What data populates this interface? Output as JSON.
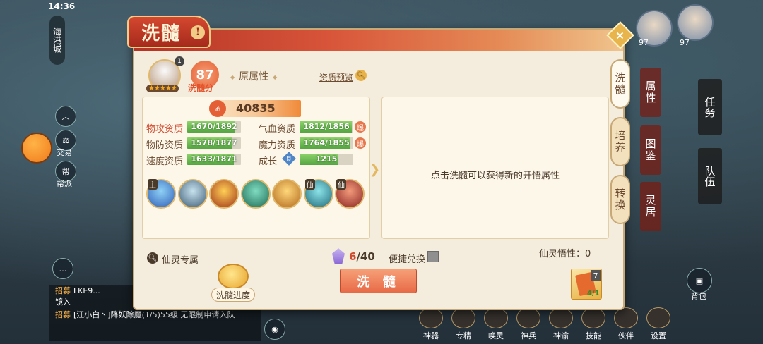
{
  "status": {
    "time": "14:36"
  },
  "background_ui": {
    "location_tab": "海港城",
    "side_buttons": [
      "交易",
      "帮派"
    ],
    "chat": [
      {
        "tag": "招募",
        "text": "LKE9..."
      },
      {
        "tag": "",
        "text": "镜入"
      },
      {
        "tag": "招募",
        "text": "[江小白丶]降妖除魔(1/5)55级 无限制申请入队"
      }
    ],
    "bottom_menu": [
      "神器",
      "专精",
      "唤灵",
      "神兵",
      "神谕",
      "技能",
      "伙伴",
      "设置"
    ],
    "bag_label": "背包",
    "right_buttons": [
      "任务",
      "队伍"
    ],
    "avatar_levels": [
      "97",
      "97"
    ]
  },
  "dialog": {
    "title": "洗髓",
    "title_badge": "!",
    "close_icon": "×",
    "tabs": [
      {
        "label": "洗髓",
        "active": true
      },
      {
        "label": "培养",
        "active": false
      },
      {
        "label": "转换",
        "active": false
      }
    ],
    "outer_tabs": [
      "属性",
      "图鉴",
      "灵居"
    ],
    "hero": {
      "index": "1",
      "stars": "★★★★★"
    },
    "score": {
      "value": "87",
      "label": "洗髓分"
    },
    "original_attr": "原属性",
    "preview_link": "资质预览",
    "power": "40835",
    "stats": [
      {
        "label": "物攻资质",
        "value": "1670/1892",
        "fill": 0.883,
        "red": true
      },
      {
        "label": "物防资质",
        "value": "1578/1877",
        "fill": 0.841,
        "red": false
      },
      {
        "label": "速度资质",
        "value": "1633/1871",
        "fill": 0.873,
        "red": false
      },
      {
        "label": "气血资质",
        "value": "1812/1856",
        "fill": 0.976,
        "red": false,
        "badge": "爆"
      },
      {
        "label": "魔力资质",
        "value": "1764/1855",
        "fill": 0.951,
        "red": false,
        "badge": "爆"
      },
      {
        "label": "成长",
        "value": "1215",
        "fill": 0.72,
        "red": false,
        "grade": "良"
      }
    ],
    "skills": [
      {
        "tag": "主",
        "colors": [
          "#2f5fb8",
          "#8fd0f5"
        ]
      },
      {
        "tag": "",
        "colors": [
          "#3d5c74",
          "#c6e1ee"
        ]
      },
      {
        "tag": "",
        "colors": [
          "#a0341c",
          "#ffcf54"
        ]
      },
      {
        "tag": "",
        "colors": [
          "#1e6a54",
          "#7fdcc0"
        ]
      },
      {
        "tag": "",
        "colors": [
          "#b26a1f",
          "#ffd77a"
        ]
      },
      {
        "tag": "仙",
        "colors": [
          "#1f6a7a",
          "#8ce3e8"
        ]
      },
      {
        "tag": "仙",
        "colors": [
          "#8a2424",
          "#f29a7a"
        ]
      }
    ],
    "hint": "点击洗髓可以获得新的开悟属性",
    "exclusive": "仙灵专属",
    "progress_label": "洗髓进度",
    "crystals": {
      "current": "6",
      "total": "/40"
    },
    "quick_exchange": "便捷兑换",
    "insight": "仙灵悟性：0",
    "wash_button": "洗 髓",
    "item": {
      "count": "7",
      "fraction": "4/1"
    }
  }
}
